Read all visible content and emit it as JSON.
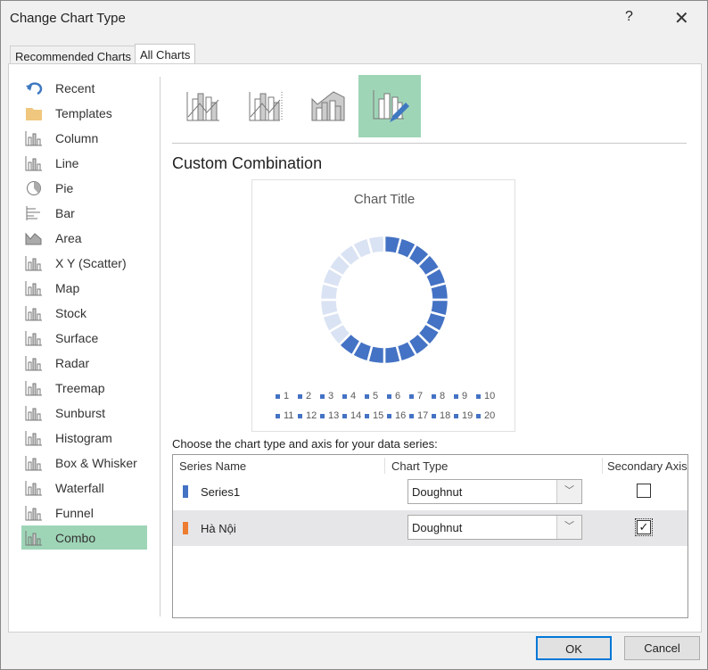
{
  "window": {
    "title": "Change Chart Type",
    "help": "?",
    "close": "✕"
  },
  "tabs": [
    {
      "label": "Recommended Charts"
    },
    {
      "label": "All Charts"
    }
  ],
  "sidebar": {
    "items": [
      {
        "label": "Recent",
        "icon": "recent-icon"
      },
      {
        "label": "Templates",
        "icon": "folder-icon"
      },
      {
        "label": "Column",
        "icon": "column-chart-icon"
      },
      {
        "label": "Line",
        "icon": "line-chart-icon"
      },
      {
        "label": "Pie",
        "icon": "pie-chart-icon"
      },
      {
        "label": "Bar",
        "icon": "bar-chart-icon"
      },
      {
        "label": "Area",
        "icon": "area-chart-icon"
      },
      {
        "label": "X Y (Scatter)",
        "icon": "scatter-chart-icon"
      },
      {
        "label": "Map",
        "icon": "map-icon"
      },
      {
        "label": "Stock",
        "icon": "stock-chart-icon"
      },
      {
        "label": "Surface",
        "icon": "surface-chart-icon"
      },
      {
        "label": "Radar",
        "icon": "radar-chart-icon"
      },
      {
        "label": "Treemap",
        "icon": "treemap-icon"
      },
      {
        "label": "Sunburst",
        "icon": "sunburst-icon"
      },
      {
        "label": "Histogram",
        "icon": "histogram-icon"
      },
      {
        "label": "Box & Whisker",
        "icon": "box-whisker-icon"
      },
      {
        "label": "Waterfall",
        "icon": "waterfall-icon"
      },
      {
        "label": "Funnel",
        "icon": "funnel-icon"
      },
      {
        "label": "Combo",
        "icon": "combo-chart-icon"
      }
    ],
    "selected": "Combo"
  },
  "main": {
    "heading": "Custom Combination",
    "choose_label": "Choose the chart type and axis for your data series:"
  },
  "table": {
    "headers": [
      "Series Name",
      "Chart Type",
      "Secondary Axis"
    ],
    "rows": [
      {
        "name": "Series1",
        "color": "#4472c4",
        "type": "Doughnut",
        "secondary": false
      },
      {
        "name": "Hà Nội",
        "color": "#ed7d31",
        "type": "Doughnut",
        "secondary": true
      }
    ]
  },
  "buttons": {
    "ok": "OK",
    "cancel": "Cancel"
  },
  "colors": {
    "accent": "#9fd5b7",
    "dark": "#4472c4",
    "light": "#dae3f3"
  },
  "chart_data": {
    "type": "pie",
    "subtype": "doughnut",
    "title": "Chart Title",
    "legend": [
      "1",
      "2",
      "3",
      "4",
      "5",
      "6",
      "7",
      "8",
      "9",
      "10",
      "11",
      "12",
      "13",
      "14",
      "15",
      "16",
      "17",
      "18",
      "19",
      "20"
    ],
    "segments": 24,
    "filled_segments": 15
  }
}
